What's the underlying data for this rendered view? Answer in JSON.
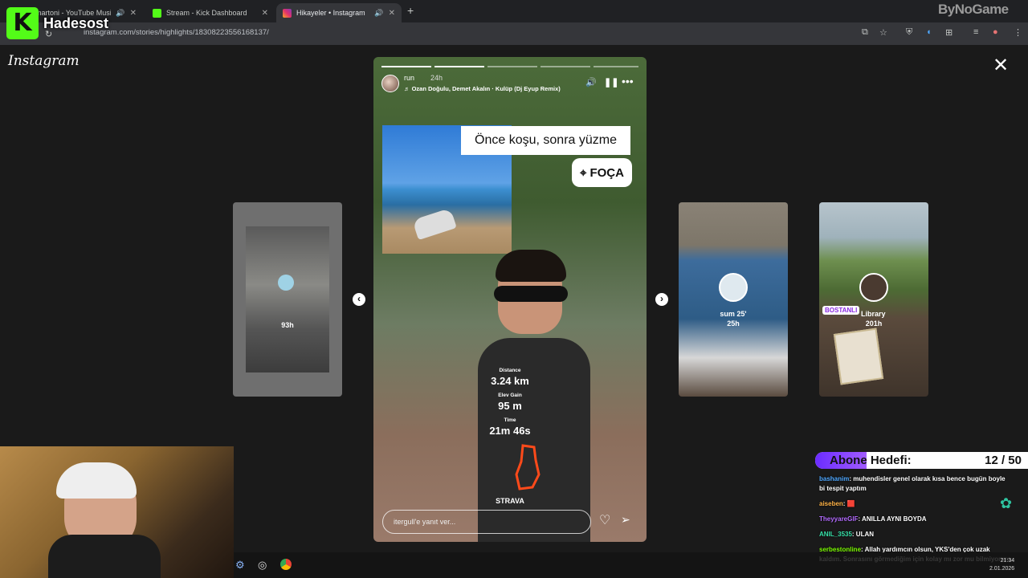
{
  "browser": {
    "tabs": [
      {
        "title": "Sumartoni - YouTube Music",
        "active": false
      },
      {
        "title": "Stream - Kick Dashboard",
        "active": false
      },
      {
        "title": "Hikayeler • Instagram",
        "active": true
      }
    ],
    "new_tab": "+",
    "url": "instagram.com/stories/highlights/18308223556168137/"
  },
  "overlay": {
    "kick_name": "Hadesost",
    "kick_letter": "K",
    "brand": "ByNoGame"
  },
  "instagram": {
    "logo": "Instagram",
    "close": "✕",
    "story": {
      "user": "run",
      "time": "24h",
      "music": "♬ Ozan Doğulu, Demet Akalın · Kulüp (Dj Eyup Remix)",
      "caption": "Önce koşu, sonra yüzme",
      "location": "FOÇA",
      "distance_label": "Distance",
      "distance_value": "3.24 km",
      "elev_label": "Elev Gain",
      "elev_value": "95 m",
      "time_label": "Time",
      "time_value": "21m 46s",
      "strava": "STRAVA",
      "reply_placeholder": "itergull'e yanıt ver...",
      "progress_total": 5,
      "progress_done": 2
    },
    "side_stories": [
      {
        "label": "93h"
      },
      {
        "label": "sum 25'",
        "time": "25h"
      },
      {
        "label": "Library",
        "sticker": "BOSTANLI",
        "time": "201h"
      }
    ],
    "prev": "‹",
    "next": "›"
  },
  "stream": {
    "goal_title": "Abone Hedefi:",
    "goal_count": "12 / 50",
    "goal_fraction": 0.24,
    "chat": [
      {
        "user": "bashanim",
        "color": "#4fa8ff",
        "text": ": muhendisler genel olarak kısa bence bugün boyle bi tespit yaptım"
      },
      {
        "user": "aiseben",
        "color": "#ffb347",
        "text": ": 🟥"
      },
      {
        "user": "TheyyareGIF",
        "color": "#b36bff",
        "text": ": ANILLA AYNI BOYDA"
      },
      {
        "user": "ANIL_3535",
        "color": "#37e0a8",
        "text": ": ULAN"
      },
      {
        "user": "serbestonline",
        "color": "#7cfc00",
        "text": ": Allah yardımcın olsun, YKS'den çok uzak kaldım. Sonrasını görmediğim için kolay mı zor mu bilmiyorum"
      }
    ],
    "clock_time": "21:34",
    "clock_date": "2.01.2026"
  }
}
